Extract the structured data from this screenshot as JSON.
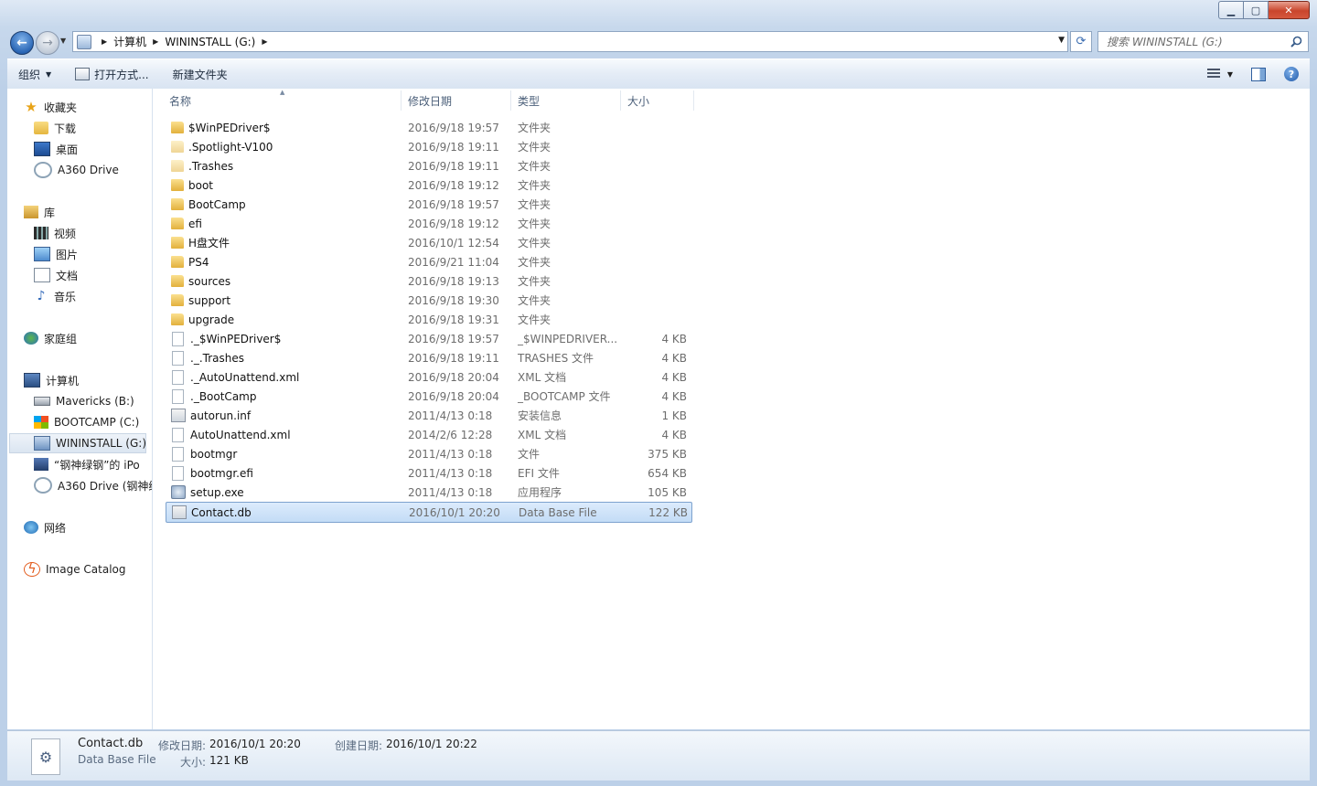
{
  "nav": {
    "breadcrumbs": [
      "计算机",
      "WININSTALL (G:)"
    ],
    "search_placeholder": "搜索 WININSTALL (G:)"
  },
  "toolbar": {
    "organize": "组织",
    "open_with": "打开方式...",
    "new_folder": "新建文件夹"
  },
  "sidebar": {
    "favorites": {
      "label": "收藏夹",
      "items": [
        {
          "label": "下载",
          "icon": "download-folder-icon"
        },
        {
          "label": "桌面",
          "icon": "desktop-icon"
        },
        {
          "label": "A360 Drive",
          "icon": "cloud-drive-icon"
        }
      ]
    },
    "libraries": {
      "label": "库",
      "items": [
        {
          "label": "视频",
          "icon": "video-library-icon"
        },
        {
          "label": "图片",
          "icon": "picture-library-icon"
        },
        {
          "label": "文档",
          "icon": "document-library-icon"
        },
        {
          "label": "音乐",
          "icon": "music-library-icon"
        }
      ]
    },
    "homegroup": {
      "label": "家庭组"
    },
    "computer": {
      "label": "计算机",
      "items": [
        {
          "label": "Mavericks (B:)",
          "icon": "drive-icon"
        },
        {
          "label": "BOOTCAMP (C:)",
          "icon": "windows-drive-icon"
        },
        {
          "label": "WININSTALL (G:)",
          "icon": "usb-drive-icon",
          "selected": true
        },
        {
          "label": "“钢神绿钢”的 iPo",
          "icon": "ipod-icon"
        },
        {
          "label": "A360 Drive (钢神绿",
          "icon": "cloud-drive-icon"
        }
      ]
    },
    "network": {
      "label": "网络"
    },
    "image_catalog": {
      "label": "Image Catalog"
    }
  },
  "columns": {
    "name": "名称",
    "date": "修改日期",
    "type": "类型",
    "size": "大小"
  },
  "files": [
    {
      "name": "$WinPEDriver$",
      "date": "2016/9/18 19:57",
      "type": "文件夹",
      "size": "",
      "icon": "folder"
    },
    {
      "name": ".Spotlight-V100",
      "date": "2016/9/18 19:11",
      "type": "文件夹",
      "size": "",
      "icon": "folder-hidden"
    },
    {
      "name": ".Trashes",
      "date": "2016/9/18 19:11",
      "type": "文件夹",
      "size": "",
      "icon": "folder-hidden"
    },
    {
      "name": "boot",
      "date": "2016/9/18 19:12",
      "type": "文件夹",
      "size": "",
      "icon": "folder"
    },
    {
      "name": "BootCamp",
      "date": "2016/9/18 19:57",
      "type": "文件夹",
      "size": "",
      "icon": "folder"
    },
    {
      "name": "efi",
      "date": "2016/9/18 19:12",
      "type": "文件夹",
      "size": "",
      "icon": "folder"
    },
    {
      "name": "H盘文件",
      "date": "2016/10/1 12:54",
      "type": "文件夹",
      "size": "",
      "icon": "folder"
    },
    {
      "name": "PS4",
      "date": "2016/9/21 11:04",
      "type": "文件夹",
      "size": "",
      "icon": "folder"
    },
    {
      "name": "sources",
      "date": "2016/9/18 19:13",
      "type": "文件夹",
      "size": "",
      "icon": "folder"
    },
    {
      "name": "support",
      "date": "2016/9/18 19:30",
      "type": "文件夹",
      "size": "",
      "icon": "folder"
    },
    {
      "name": "upgrade",
      "date": "2016/9/18 19:31",
      "type": "文件夹",
      "size": "",
      "icon": "folder"
    },
    {
      "name": "._$WinPEDriver$",
      "date": "2016/9/18 19:57",
      "type": "_$WINPEDRIVER...",
      "size": "4 KB",
      "icon": "file"
    },
    {
      "name": "._.Trashes",
      "date": "2016/9/18 19:11",
      "type": "TRASHES 文件",
      "size": "4 KB",
      "icon": "file"
    },
    {
      "name": "._AutoUnattend.xml",
      "date": "2016/9/18 20:04",
      "type": "XML 文档",
      "size": "4 KB",
      "icon": "file-xml"
    },
    {
      "name": "._BootCamp",
      "date": "2016/9/18 20:04",
      "type": "_BOOTCAMP 文件",
      "size": "4 KB",
      "icon": "file"
    },
    {
      "name": "autorun.inf",
      "date": "2011/4/13 0:18",
      "type": "安装信息",
      "size": "1 KB",
      "icon": "file-config"
    },
    {
      "name": "AutoUnattend.xml",
      "date": "2014/2/6 12:28",
      "type": "XML 文档",
      "size": "4 KB",
      "icon": "file-xml"
    },
    {
      "name": "bootmgr",
      "date": "2011/4/13 0:18",
      "type": "文件",
      "size": "375 KB",
      "icon": "file"
    },
    {
      "name": "bootmgr.efi",
      "date": "2011/4/13 0:18",
      "type": "EFI 文件",
      "size": "654 KB",
      "icon": "file"
    },
    {
      "name": "setup.exe",
      "date": "2011/4/13 0:18",
      "type": "应用程序",
      "size": "105 KB",
      "icon": "file-exe"
    },
    {
      "name": "Contact.db",
      "date": "2016/10/1 20:20",
      "type": "Data Base File",
      "size": "122 KB",
      "icon": "file-db",
      "selected": true
    }
  ],
  "details": {
    "name": "Contact.db",
    "type": "Data Base File",
    "modified_label": "修改日期:",
    "modified": "2016/10/1 20:20",
    "created_label": "创建日期:",
    "created": "2016/10/1 20:22",
    "size_label": "大小:",
    "size": "121 KB"
  }
}
